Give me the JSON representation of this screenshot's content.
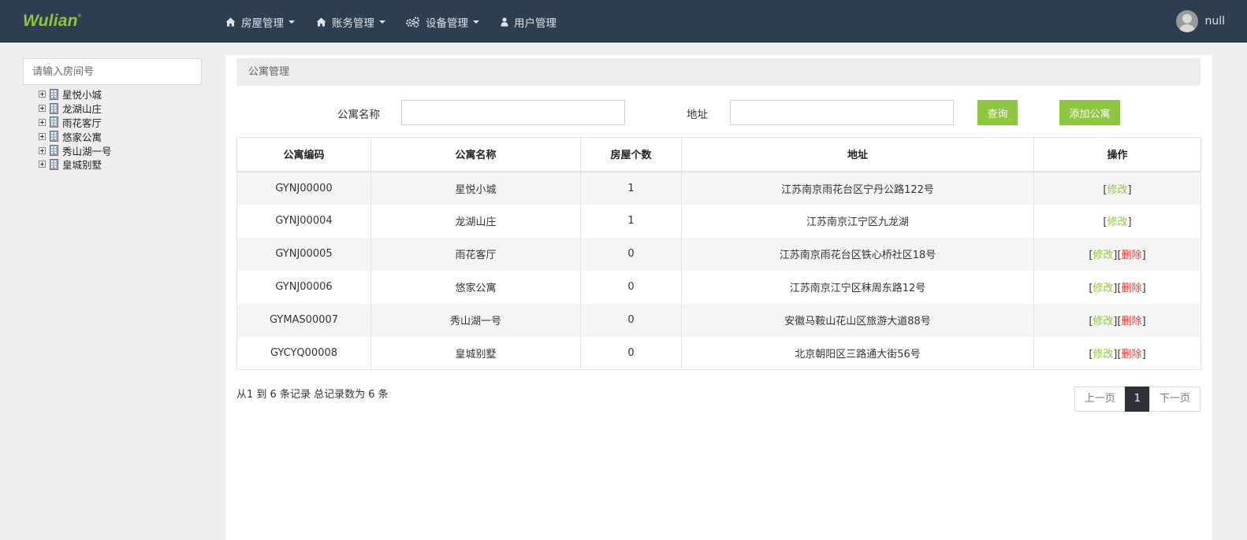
{
  "brand": {
    "name": "Wulian",
    "mark": "®"
  },
  "nav": [
    {
      "label": "房屋管理",
      "icon": "home-icon",
      "dropdown": true
    },
    {
      "label": "账务管理",
      "icon": "home-icon",
      "dropdown": true
    },
    {
      "label": "设备管理",
      "icon": "cogs-icon",
      "dropdown": true
    },
    {
      "label": "用户管理",
      "icon": "user-icon",
      "dropdown": false
    }
  ],
  "user": {
    "name": "null"
  },
  "sidebar": {
    "search_placeholder": "请输入房间号",
    "tree": [
      "星悦小城",
      "龙湖山庄",
      "雨花客厅",
      "悠家公寓",
      "秀山湖一号",
      "皇城别墅"
    ]
  },
  "panel": {
    "title": "公寓管理"
  },
  "filters": {
    "name_label": "公寓名称",
    "address_label": "地址",
    "name_value": "",
    "address_value": "",
    "query_button": "查询",
    "add_button": "添加公寓"
  },
  "table": {
    "headers": [
      "公寓编码",
      "公寓名称",
      "房屋个数",
      "地址",
      "操作"
    ],
    "rows": [
      {
        "code": "GYNJ00000",
        "name": "星悦小城",
        "count": "1",
        "address": "江苏南京雨花台区宁丹公路122号",
        "edit": "修改",
        "del": ""
      },
      {
        "code": "GYNJ00004",
        "name": "龙湖山庄",
        "count": "1",
        "address": "江苏南京江宁区九龙湖",
        "edit": "修改",
        "del": ""
      },
      {
        "code": "GYNJ00005",
        "name": "雨花客厅",
        "count": "0",
        "address": "江苏南京雨花台区铁心桥社区18号",
        "edit": "修改",
        "del": "删除"
      },
      {
        "code": "GYNJ00006",
        "name": "悠家公寓",
        "count": "0",
        "address": "江苏南京江宁区秣周东路12号",
        "edit": "修改",
        "del": "删除"
      },
      {
        "code": "GYMAS00007",
        "name": "秀山湖一号",
        "count": "0",
        "address": "安徽马鞍山花山区旅游大道88号",
        "edit": "修改",
        "del": "删除"
      },
      {
        "code": "GYCYQ00008",
        "name": "皇城别墅",
        "count": "0",
        "address": "北京朝阳区三路通大街56号",
        "edit": "修改",
        "del": "删除"
      }
    ]
  },
  "footer": {
    "records": "从1 到 6 条记录 总记录数为 6 条",
    "prev": "上一页",
    "page": "1",
    "next": "下一页"
  },
  "colors": {
    "navbar": "#2c3e50",
    "accent": "#8dc63f",
    "danger": "#e0413a"
  }
}
